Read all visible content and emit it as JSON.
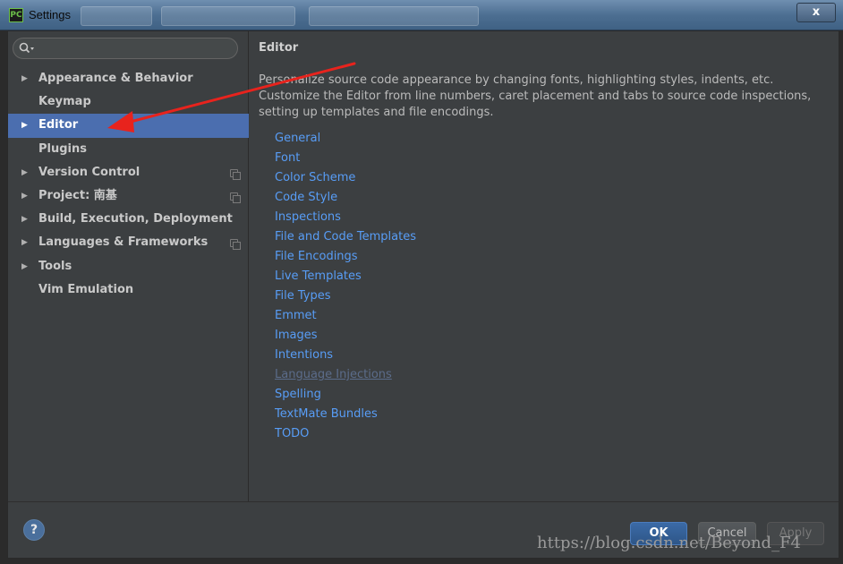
{
  "window": {
    "title": "Settings",
    "app_icon_text": "PC",
    "close_glyph": "x"
  },
  "search": {
    "placeholder": "",
    "value": ""
  },
  "sidebar": {
    "items": [
      {
        "label": "Appearance & Behavior",
        "expandable": true,
        "selected": false,
        "project_icon": false
      },
      {
        "label": "Keymap",
        "expandable": false,
        "selected": false,
        "project_icon": false
      },
      {
        "label": "Editor",
        "expandable": true,
        "selected": true,
        "project_icon": false
      },
      {
        "label": "Plugins",
        "expandable": false,
        "selected": false,
        "project_icon": false
      },
      {
        "label": "Version Control",
        "expandable": true,
        "selected": false,
        "project_icon": true
      },
      {
        "label": "Project: 南基",
        "expandable": true,
        "selected": false,
        "project_icon": true
      },
      {
        "label": "Build, Execution, Deployment",
        "expandable": true,
        "selected": false,
        "project_icon": false
      },
      {
        "label": "Languages & Frameworks",
        "expandable": true,
        "selected": false,
        "project_icon": true
      },
      {
        "label": "Tools",
        "expandable": true,
        "selected": false,
        "project_icon": false
      },
      {
        "label": "Vim Emulation",
        "expandable": false,
        "selected": false,
        "project_icon": false
      }
    ]
  },
  "main": {
    "title": "Editor",
    "description": "Personalize source code appearance by changing fonts, highlighting styles, indents, etc. Customize the Editor from line numbers, caret placement and tabs to source code inspections, setting up templates and file encodings.",
    "links": [
      {
        "label": "General",
        "dim": false
      },
      {
        "label": "Font",
        "dim": false
      },
      {
        "label": "Color Scheme",
        "dim": false
      },
      {
        "label": "Code Style",
        "dim": false
      },
      {
        "label": "Inspections",
        "dim": false
      },
      {
        "label": "File and Code Templates",
        "dim": false
      },
      {
        "label": "File Encodings",
        "dim": false
      },
      {
        "label": "Live Templates",
        "dim": false
      },
      {
        "label": "File Types",
        "dim": false
      },
      {
        "label": "Emmet",
        "dim": false
      },
      {
        "label": "Images",
        "dim": false
      },
      {
        "label": "Intentions",
        "dim": false
      },
      {
        "label": "Language Injections",
        "dim": true
      },
      {
        "label": "Spelling",
        "dim": false
      },
      {
        "label": "TextMate Bundles",
        "dim": false
      },
      {
        "label": "TODO",
        "dim": false
      }
    ]
  },
  "footer": {
    "help_label": "?",
    "ok_label": "OK",
    "cancel_label": "Cancel",
    "apply_label": "Apply"
  },
  "watermark": "https://blog.csdn.net/Beyond_F4",
  "colors": {
    "selection": "#4b6eaf",
    "link": "#589df6",
    "annotation_arrow": "#e8231d"
  }
}
